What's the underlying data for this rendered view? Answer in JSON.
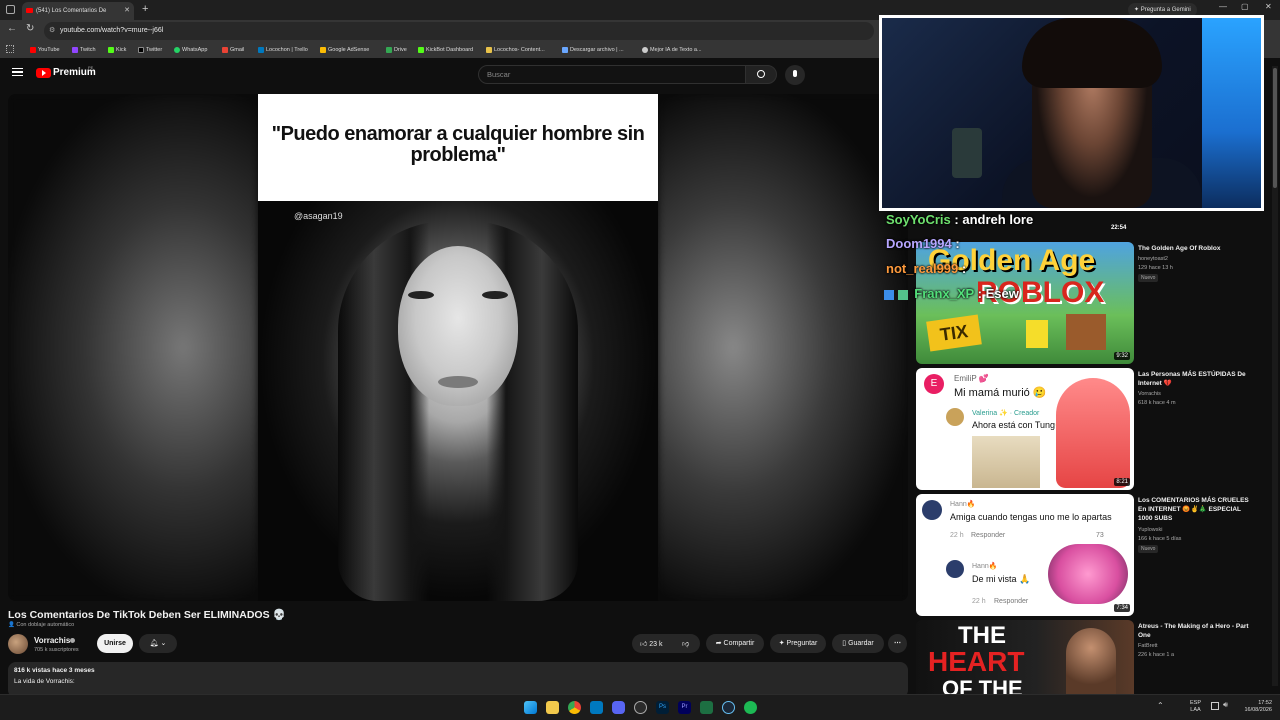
{
  "browser": {
    "tab_title": "(541) Los Comentarios De",
    "url": "youtube.com/watch?v=mure--j66l",
    "gemini_button": "Pregunta a Gemini",
    "bookmarks": [
      "YouTube",
      "Twitch",
      "Kick",
      "Twitter",
      "WhatsApp",
      "Gmail",
      "Locochon | Trello",
      "Google AdSense",
      "Drive",
      "KickBot Dashboard",
      "Locochos- Content...",
      "Descargar archivo | ...",
      "Mejor IA de Texto a..."
    ]
  },
  "youtube": {
    "logo": "Premium",
    "logo_region": "PE",
    "search_placeholder": "Buscar",
    "video": {
      "text_overlay": "\"Puedo enamorar a cualquier hombre sin problema\"",
      "watermark": "@asagan19",
      "title": "Los Comentarios De TikTok Deben Ser ELIMINADOS 💀",
      "dubbing": "Con doblaje automático",
      "channel": "Vorrachis",
      "subscribers": "705 k suscriptores",
      "join_label": "Unirse",
      "likes": "23 k",
      "share_label": "Compartir",
      "ask_label": "Preguntar",
      "save_label": "Guardar",
      "views_line": "816 k vistas  hace 3 meses",
      "desc_line": "La vida de Vorrachis:"
    },
    "recommendations": [
      {
        "title": "The Golden Age Of Roblox",
        "channel": "honeytoast2",
        "meta": "129  hace 13 h",
        "badge": "Nuevo",
        "duration": "9:32",
        "prev_duration": "22:54"
      },
      {
        "title": "Las Personas MÁS ESTÚPIDAS De Internet 💔",
        "channel": "Vorrachis",
        "meta": "618 k  hace 4 m",
        "duration": "8:21"
      },
      {
        "title": "Los COMENTARIOS MÁS CRUELES En INTERNET 😡✌️🎄 ESPECIAL 1000 SUBS",
        "channel": "Yuplowski",
        "meta": "166 k  hace 5 días",
        "badge": "Nuevo",
        "duration": "7:34"
      },
      {
        "title": "Atreus - The Making of a Hero - Part One",
        "channel": "FatBrett",
        "meta": "226 k  hace 1 a"
      }
    ],
    "thumb_texts": {
      "golden": "Golden Age",
      "roblox": "ROBLOX",
      "tix": "TIX",
      "emilip_user": "EmiliP 💕",
      "emilip_msg": "Mi mamá murió 🥲",
      "valerina_user": "Valerina ✨ · Creador",
      "valerina_msg": "Ahora está con Tung😏",
      "hann_user": "Hann🔥",
      "hann_msg1": "Amiga cuando tengas uno me lo apartas",
      "hann_time": "22 h",
      "hann_reply": "Responder",
      "hann_likes": "73",
      "hann_msg2": "De mi vista 🙏",
      "heart1": "THE",
      "heart2": "HEART",
      "heart3": "OF THE"
    }
  },
  "stream_chat": [
    {
      "user": "SoyYoCris",
      "sep": ":",
      "msg": "andreh lore",
      "color": "#6ee06e"
    },
    {
      "user": "Doom1994",
      "sep": ":",
      "msg": "",
      "color": "#b7a6ff"
    },
    {
      "user": "not_real999",
      "sep": ":",
      "msg": "",
      "color": "#ff9a3c"
    },
    {
      "user": "Franx_XP",
      "sep": ":",
      "msg": "Esew",
      "color": "#52e07a"
    }
  ],
  "taskbar": {
    "lang": "ESP",
    "layout": "LAA",
    "time": "17:52",
    "date": "16/08/2026"
  },
  "colors": {
    "yt_red": "#ff0000",
    "bg": "#0f0f0f",
    "pill": "#272727"
  }
}
